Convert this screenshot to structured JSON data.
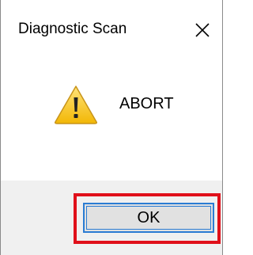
{
  "window": {
    "title": "Diagnostic Scan",
    "close_icon": "close-icon"
  },
  "content": {
    "icon": "warning-icon",
    "message": "ABORT"
  },
  "footer": {
    "ok_label": "OK"
  },
  "colors": {
    "highlight": "#e0101a",
    "button_border": "#2b7cd3",
    "button_bg": "#e1e1e1",
    "footer_bg": "#f0f0f0",
    "warning_fill": "#f7c21b"
  }
}
